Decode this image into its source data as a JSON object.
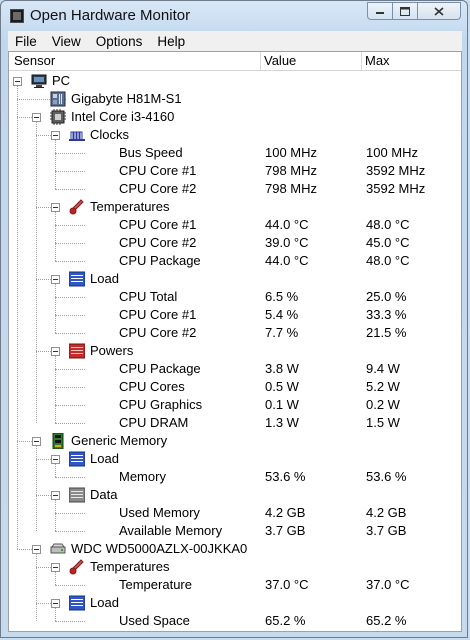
{
  "window": {
    "title": "Open Hardware Monitor"
  },
  "menu": [
    "File",
    "View",
    "Options",
    "Help"
  ],
  "columns": {
    "sensor": "Sensor",
    "value": "Value",
    "max": "Max"
  },
  "rows": [
    {
      "label": "PC",
      "value": "",
      "max": "",
      "icon": "computer-icon"
    },
    {
      "label": "Gigabyte H81M-S1",
      "value": "",
      "max": "",
      "icon": "motherboard-icon"
    },
    {
      "label": "Intel Core i3-4160",
      "value": "",
      "max": "",
      "icon": "cpu-icon"
    },
    {
      "label": "Clocks",
      "value": "",
      "max": "",
      "icon": "clock-icon"
    },
    {
      "label": "Bus Speed",
      "value": "100 MHz",
      "max": "100 MHz"
    },
    {
      "label": "CPU Core #1",
      "value": "798 MHz",
      "max": "3592 MHz"
    },
    {
      "label": "CPU Core #2",
      "value": "798 MHz",
      "max": "3592 MHz"
    },
    {
      "label": "Temperatures",
      "value": "",
      "max": "",
      "icon": "thermometer-icon"
    },
    {
      "label": "CPU Core #1",
      "value": "44.0 °C",
      "max": "48.0 °C"
    },
    {
      "label": "CPU Core #2",
      "value": "39.0 °C",
      "max": "45.0 °C"
    },
    {
      "label": "CPU Package",
      "value": "44.0 °C",
      "max": "48.0 °C"
    },
    {
      "label": "Load",
      "value": "",
      "max": "",
      "icon": "load-icon"
    },
    {
      "label": "CPU Total",
      "value": "6.5 %",
      "max": "25.0 %"
    },
    {
      "label": "CPU Core #1",
      "value": "5.4 %",
      "max": "33.3 %"
    },
    {
      "label": "CPU Core #2",
      "value": "7.7 %",
      "max": "21.5 %"
    },
    {
      "label": "Powers",
      "value": "",
      "max": "",
      "icon": "power-icon"
    },
    {
      "label": "CPU Package",
      "value": "3.8 W",
      "max": "9.4 W"
    },
    {
      "label": "CPU Cores",
      "value": "0.5 W",
      "max": "5.2 W"
    },
    {
      "label": "CPU Graphics",
      "value": "0.1 W",
      "max": "0.2 W"
    },
    {
      "label": "CPU DRAM",
      "value": "1.3 W",
      "max": "1.5 W"
    },
    {
      "label": "Generic Memory",
      "value": "",
      "max": "",
      "icon": "ram-icon"
    },
    {
      "label": "Load",
      "value": "",
      "max": "",
      "icon": "load-icon"
    },
    {
      "label": "Memory",
      "value": "53.6 %",
      "max": "53.6 %"
    },
    {
      "label": "Data",
      "value": "",
      "max": "",
      "icon": "data-icon"
    },
    {
      "label": "Used Memory",
      "value": "4.2 GB",
      "max": "4.2 GB"
    },
    {
      "label": "Available Memory",
      "value": "3.7 GB",
      "max": "3.7 GB"
    },
    {
      "label": "WDC WD5000AZLX-00JKKA0",
      "value": "",
      "max": "",
      "icon": "hard-drive-icon"
    },
    {
      "label": "Temperatures",
      "value": "",
      "max": "",
      "icon": "thermometer-icon"
    },
    {
      "label": "Temperature",
      "value": "37.0 °C",
      "max": "37.0 °C"
    },
    {
      "label": "Load",
      "value": "",
      "max": "",
      "icon": "load-icon"
    },
    {
      "label": "Used Space",
      "value": "65.2 %",
      "max": "65.2 %"
    }
  ]
}
